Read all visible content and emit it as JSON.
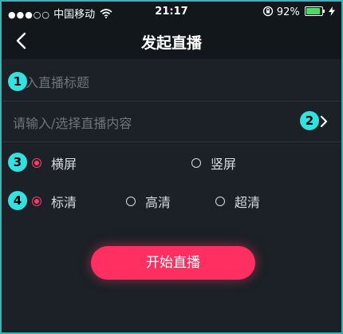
{
  "status_bar": {
    "signal": "●●●○○",
    "carrier": "中国移动",
    "time": "21:17",
    "battery_percent": "92%",
    "battery_level": 0.92
  },
  "header": {
    "title": "发起直播"
  },
  "form": {
    "title_placeholder": "输入直播标题",
    "content_placeholder": "请输入/选择直播内容"
  },
  "badges": [
    "1",
    "2",
    "3",
    "4"
  ],
  "orientation": {
    "options": [
      "横屏",
      "竖屏"
    ],
    "selected": "横屏"
  },
  "quality": {
    "options": [
      "标清",
      "高清",
      "超清"
    ],
    "selected": "标清"
  },
  "start_button_label": "开始直播",
  "colors": {
    "accent": "#ff2f61",
    "badge": "#34e0e0",
    "background": "#1b2126"
  }
}
